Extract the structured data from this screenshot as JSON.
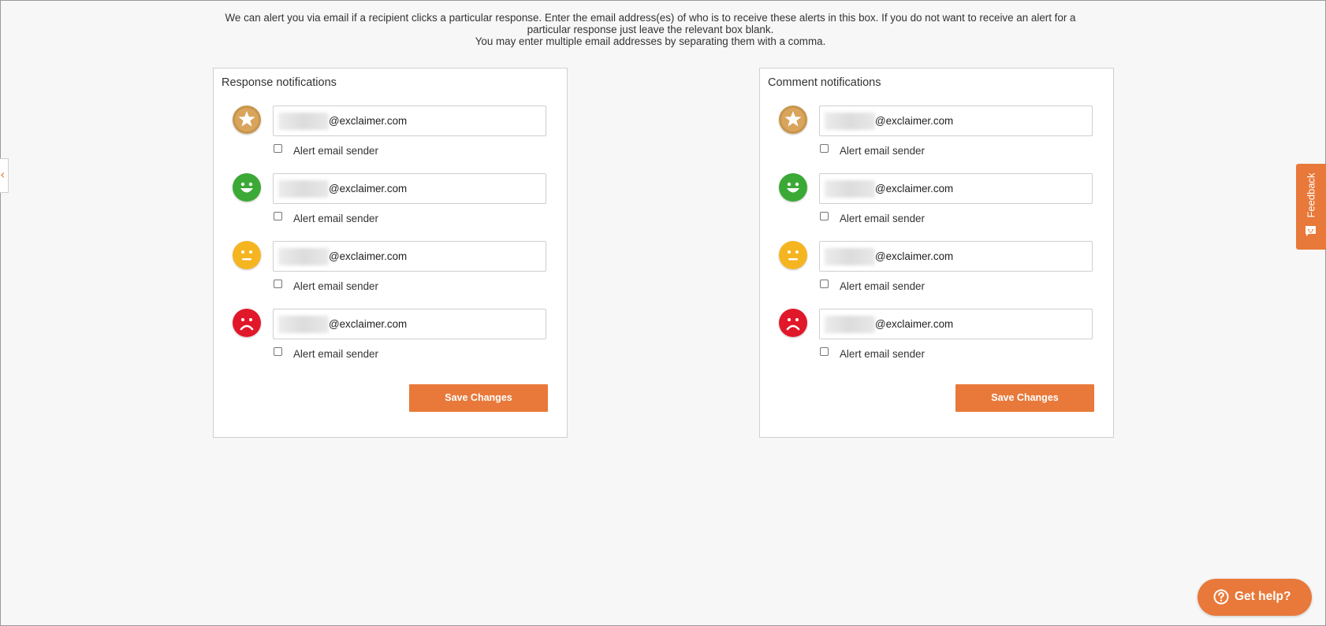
{
  "intro": {
    "line1": "We can alert you via email if a recipient clicks a particular response. Enter the email address(es) of who is to receive these alerts in this box. If you do not want to receive an alert for a particular response just leave the relevant box blank.",
    "line2": "You may enter multiple email addresses by separating them with a comma."
  },
  "panels": {
    "response": {
      "title": "Response notifications",
      "save_label": "Save Changes",
      "rows": [
        {
          "icon": "star-icon",
          "color": "#c8954b",
          "email_domain": "@exclaimer.com",
          "checkbox_label": "Alert email sender",
          "checked": false
        },
        {
          "icon": "happy-face-icon",
          "color": "#3aa935",
          "email_domain": "@exclaimer.com",
          "checkbox_label": "Alert email sender",
          "checked": false
        },
        {
          "icon": "neutral-face-icon",
          "color": "#f5b520",
          "email_domain": "@exclaimer.com",
          "checkbox_label": "Alert email sender",
          "checked": false
        },
        {
          "icon": "sad-face-icon",
          "color": "#e0182a",
          "email_domain": "@exclaimer.com",
          "checkbox_label": "Alert email sender",
          "checked": false
        }
      ]
    },
    "comment": {
      "title": "Comment notifications",
      "save_label": "Save Changes",
      "rows": [
        {
          "icon": "star-icon",
          "color": "#c8954b",
          "email_domain": "@exclaimer.com",
          "checkbox_label": "Alert email sender",
          "checked": false
        },
        {
          "icon": "happy-face-icon",
          "color": "#3aa935",
          "email_domain": "@exclaimer.com",
          "checkbox_label": "Alert email sender",
          "checked": false
        },
        {
          "icon": "neutral-face-icon",
          "color": "#f5b520",
          "email_domain": "@exclaimer.com",
          "checkbox_label": "Alert email sender",
          "checked": false
        },
        {
          "icon": "sad-face-icon",
          "color": "#e0182a",
          "email_domain": "@exclaimer.com",
          "checkbox_label": "Alert email sender",
          "checked": false
        }
      ]
    }
  },
  "feedback": {
    "label": "Feedback"
  },
  "help": {
    "label": "Get help?"
  },
  "colors": {
    "accent": "#e8793a"
  }
}
